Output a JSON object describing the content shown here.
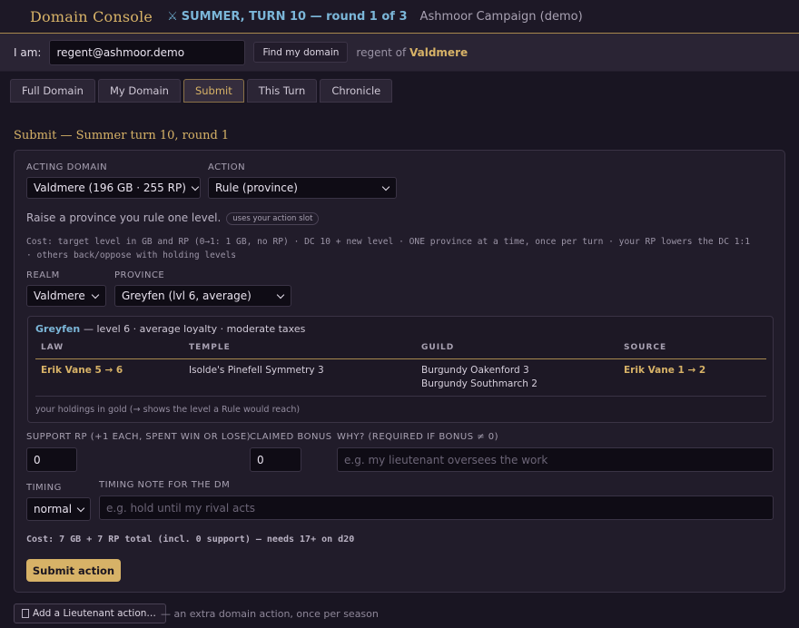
{
  "header": {
    "brand": "Domain Console",
    "turn_icon": "crossed-swords-icon",
    "turn_symbol": "⚔",
    "turn": "SUMMER, TURN 10 — round 1 of 3",
    "campaign": "Ashmoor Campaign (demo)"
  },
  "identity": {
    "label": "I am:",
    "email": "regent@ashmoor.demo",
    "find_button": "Find my domain",
    "regent_prefix": "regent of",
    "domain": "Valdmere"
  },
  "tabs": [
    {
      "label": "Full Domain"
    },
    {
      "label": "My Domain"
    },
    {
      "label": "Submit",
      "active": true
    },
    {
      "label": "This Turn"
    },
    {
      "label": "Chronicle"
    }
  ],
  "submit": {
    "title": "Submit — Summer turn 10, round 1",
    "acting_domain_label": "ACTING DOMAIN",
    "acting_domain_value": "Valdmere (196 GB · 255 RP)",
    "action_label": "ACTION",
    "action_value": "Rule (province)",
    "action_desc": "Raise a province you rule one level.",
    "action_badge": "uses your action slot",
    "cost_line1": "Cost: target level in GB and RP (0→1: 1 GB, no RP) · DC 10 + new level · ONE province at a time, once per turn · your RP lowers the DC 1:1",
    "cost_line2": "· others back/oppose with holding levels",
    "realm_label": "REALM",
    "realm_value": "Valdmere",
    "province_label": "PROVINCE",
    "province_value": "Greyfen (lvl 6, average)",
    "province_card": {
      "name": "Greyfen",
      "desc": "— level 6 · average loyalty · moderate taxes",
      "headers": [
        "LAW",
        "TEMPLE",
        "GUILD",
        "SOURCE"
      ],
      "law": "Erik Vane 5 → 6",
      "temple": "Isolde's Pinefell Symmetry 3",
      "guild": [
        "Burgundy Oakenford 3",
        "Burgundy Southmarch 2"
      ],
      "source": "Erik Vane 1 → 2",
      "note": "your holdings in gold (→ shows the level a Rule would reach)"
    },
    "support_label": "SUPPORT RP (+1 EACH, SPENT WIN OR LOSE)",
    "support_value": "0",
    "bonus_label": "CLAIMED BONUS",
    "bonus_value": "0",
    "why_label": "WHY? (REQUIRED IF BONUS ≠ 0)",
    "why_placeholder": "e.g. my lieutenant oversees the work",
    "timing_label": "TIMING",
    "timing_value": "normal",
    "timing_note_label": "TIMING NOTE FOR THE DM",
    "timing_note_placeholder": "e.g. hold until my rival acts",
    "total_cost": "Cost: 7 GB + 7 RP total (incl. 0 support) — needs 17+ on d20",
    "submit_button": "Submit action"
  },
  "lieutenant": {
    "button": "Add a Lieutenant action…",
    "note": "— an extra domain action, once per season"
  },
  "colors": {
    "accent": "#d7b267",
    "link": "#7bb6d8",
    "background": "#191522",
    "panel": "#211c2a"
  }
}
